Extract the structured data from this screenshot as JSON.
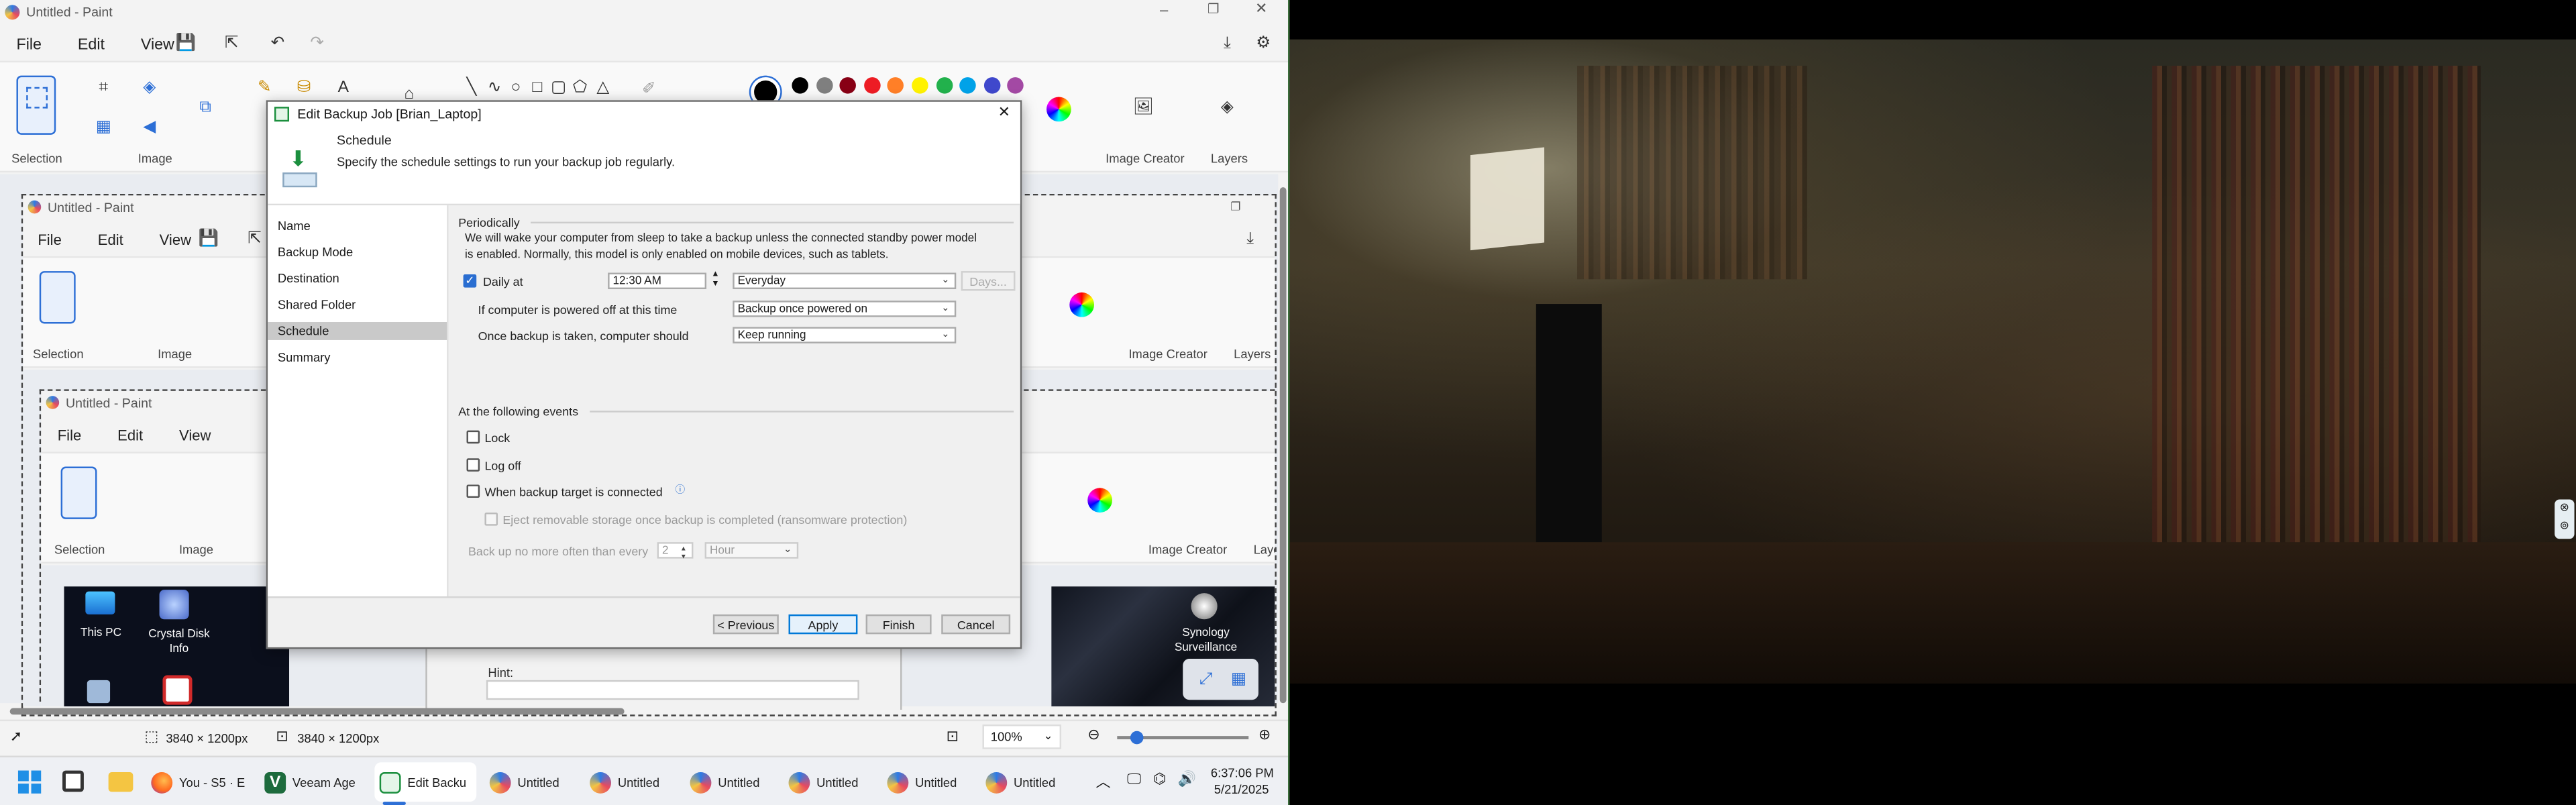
{
  "paint_main": {
    "title": "Untitled - Paint",
    "menu": [
      "File",
      "Edit",
      "View"
    ],
    "groups": {
      "selection": "Selection",
      "image": "Image",
      "image_creator": "Image Creator",
      "layers": "Layers"
    },
    "status": {
      "selection_size": "3840 × 1200px",
      "canvas_size": "3840 × 1200px",
      "zoom": "100%"
    }
  },
  "paint_nested1": {
    "title": "Untitled - Paint",
    "menu": [
      "File",
      "Edit",
      "View"
    ],
    "groups": {
      "selection": "Selection",
      "image": "Image",
      "image_creator": "Image Creator",
      "layers": "Layers"
    }
  },
  "paint_nested2": {
    "title": "Untitled - Paint",
    "menu": [
      "File",
      "Edit",
      "View"
    ],
    "groups": {
      "selection": "Selection",
      "image": "Image",
      "image_creator": "Image Creator",
      "layers": "Laye"
    }
  },
  "desktop": {
    "icons": [
      "This PC",
      "Crystal Disk Info"
    ],
    "right_icon": "Synology Surveillance"
  },
  "hint": {
    "label": "Hint:"
  },
  "palette": [
    "#000000",
    "#7f7f7f",
    "#880015",
    "#ed1c24",
    "#ff7f27",
    "#fff200",
    "#22b14c",
    "#00a2e8",
    "#3f48cc",
    "#a349a4"
  ],
  "dialog": {
    "title": "Edit Backup Job [Brian_Laptop]",
    "header_title": "Schedule",
    "header_subtitle": "Specify the schedule settings to run your backup job regularly.",
    "nav": [
      "Name",
      "Backup Mode",
      "Destination",
      "Shared Folder",
      "Schedule",
      "Summary"
    ],
    "selected_nav": "Schedule",
    "periodically_label": "Periodically",
    "wake_note_line1": "We will wake your computer from sleep to take a backup unless the connected standby power model",
    "wake_note_line2": "is enabled. Normally, this model is only enabled on mobile devices, such as tablets.",
    "daily_label": "Daily at",
    "daily_checked": true,
    "time_value": "12:30 AM",
    "frequency_value": "Everyday",
    "days_button": "Days...",
    "powered_off_label": "If computer is powered off at this time",
    "powered_off_value": "Backup once powered on",
    "after_backup_label": "Once backup is taken, computer should",
    "after_backup_value": "Keep running",
    "events_label": "At the following events",
    "lock_label": "Lock",
    "logoff_label": "Log off",
    "target_connected_label": "When backup target is connected",
    "eject_label": "Eject removable storage once backup is completed (ransomware protection)",
    "backup_limit_label": "Back up no more often than every",
    "backup_limit_value": "2",
    "backup_limit_unit": "Hour",
    "buttons": {
      "previous": "< Previous",
      "apply": "Apply",
      "finish": "Finish",
      "cancel": "Cancel"
    }
  },
  "taskbar": {
    "items": [
      "You - S5 · E",
      "Veeam Age",
      "Edit Backu",
      "Untitled",
      "Untitled",
      "Untitled",
      "Untitled",
      "Untitled",
      "Untitled"
    ],
    "time": "6:37:06 PM",
    "date": "5/21/2025"
  }
}
